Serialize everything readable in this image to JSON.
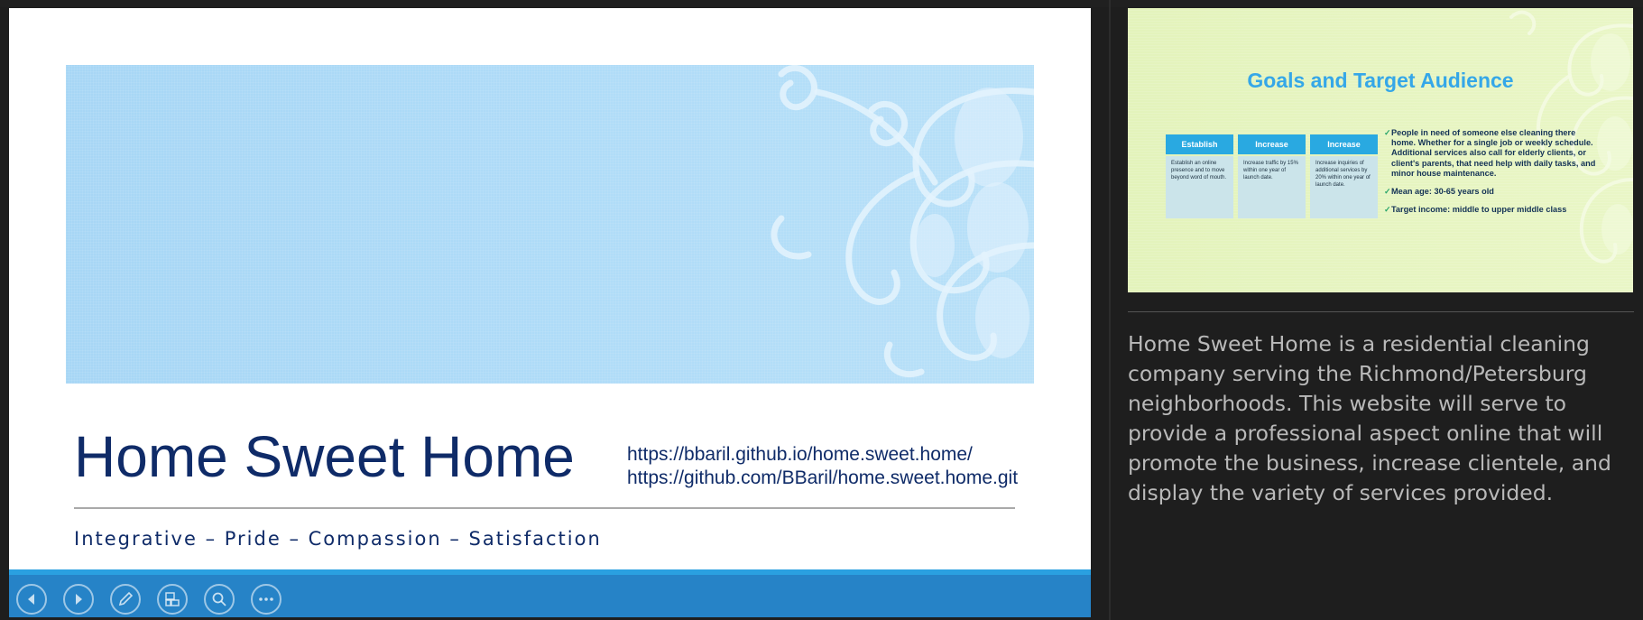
{
  "current_slide": {
    "title": "Home Sweet Home",
    "url_1": "https://bbaril.github.io/home.sweet.home/",
    "url_2": "https://github.com/BBaril/home.sweet.home.git",
    "tagline": "Integrative – Pride – Compassion – Satisfaction",
    "colors": {
      "title": "#0f2b68",
      "banner": "#a9d8f6",
      "control_bar": "#2683c7"
    }
  },
  "controls": [
    {
      "icon": "previous-icon"
    },
    {
      "icon": "next-icon"
    },
    {
      "icon": "pen-icon"
    },
    {
      "icon": "all-slides-icon"
    },
    {
      "icon": "zoom-icon"
    },
    {
      "icon": "more-options-icon"
    }
  ],
  "next_slide": {
    "title": "Goals and Target Audience",
    "goals": [
      {
        "heading": "Establish",
        "body": "Establish an online presence and to move beyond word of mouth."
      },
      {
        "heading": "Increase",
        "body": "Increase traffic by 15% within one year of launch date."
      },
      {
        "heading": "Increase",
        "body": "Increase inquiries of additional services by 20% within one year of launch date."
      }
    ],
    "bullets": [
      "People in need of someone else cleaning there home. Whether for a single job or weekly schedule. Additional services also call for elderly clients, or client's parents, that need help with daily tasks, and minor house maintenance.",
      "Mean age: 30-65 years old",
      "Target income: middle to upper middle class"
    ],
    "check_mark": "✓"
  },
  "speaker_notes": "Home Sweet Home is a residential cleaning company serving the Richmond/Petersburg neighborhoods. This website will serve to provide a professional aspect online that will promote the business, increase clientele, and display the variety of services provided."
}
